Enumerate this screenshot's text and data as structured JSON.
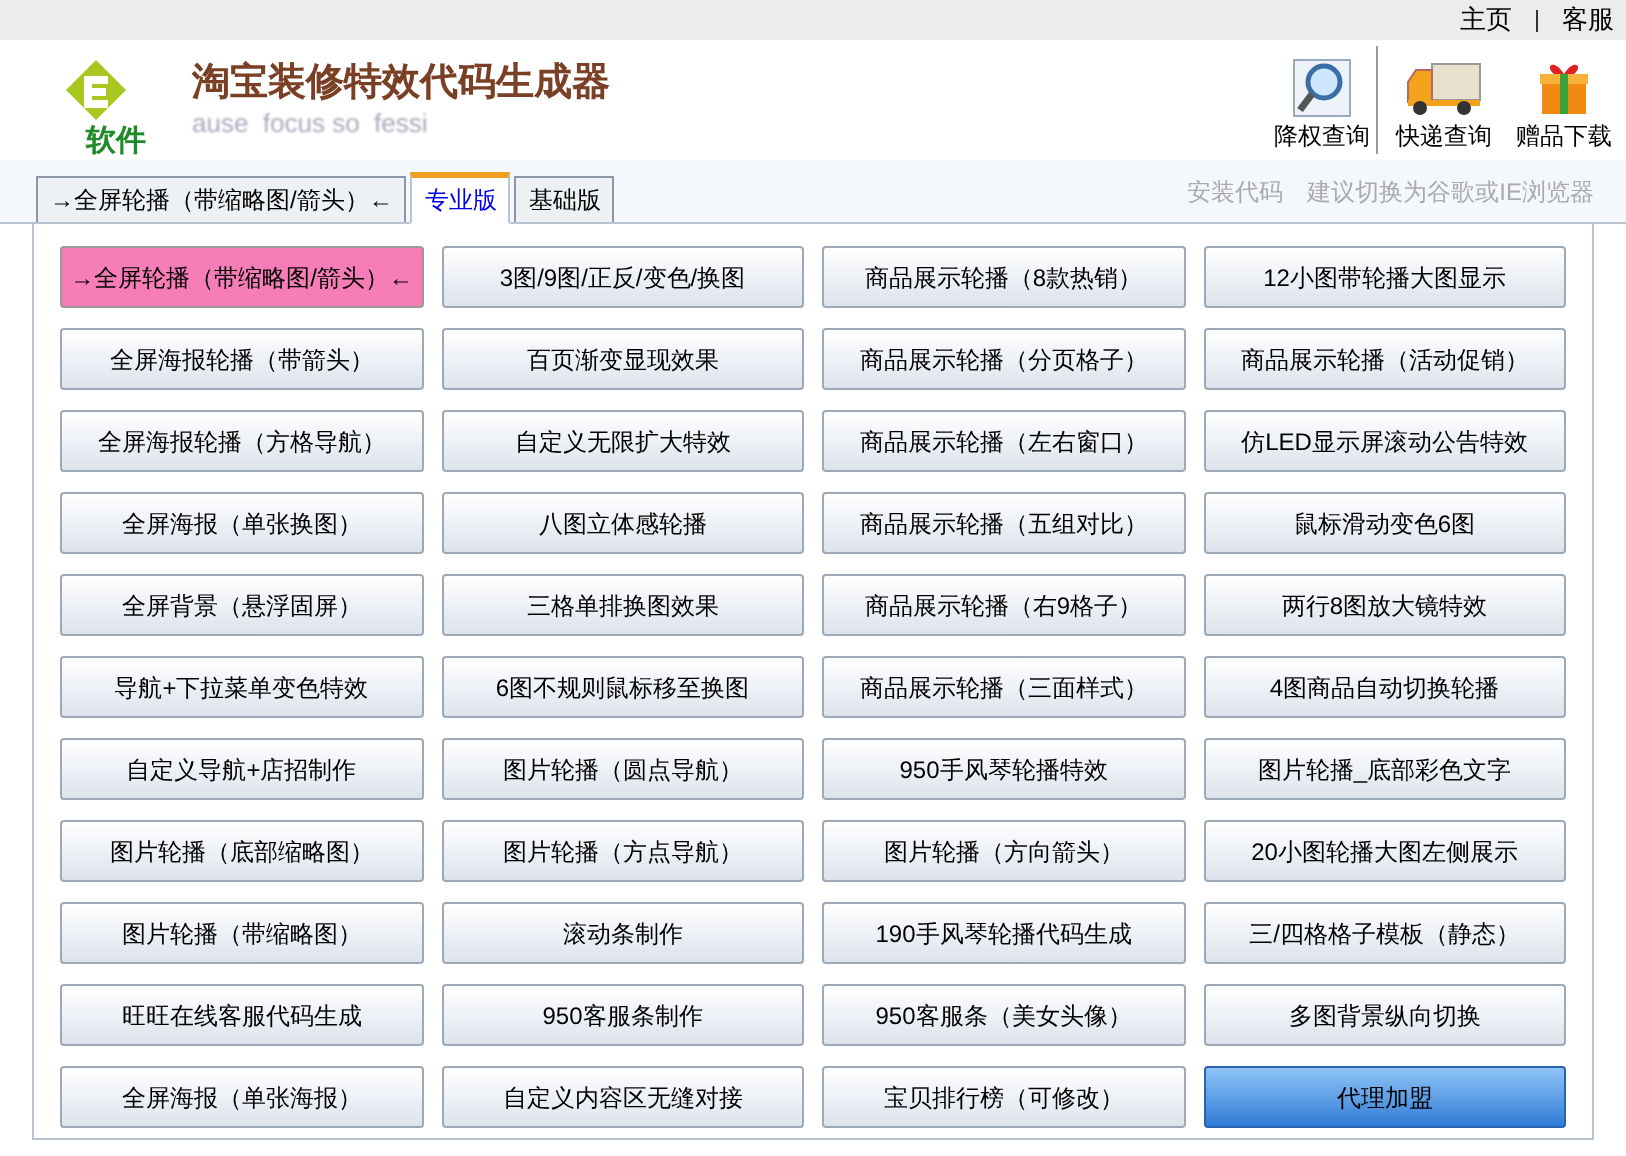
{
  "top_links": [
    "主页",
    "客服"
  ],
  "header": {
    "logo_text": "软件",
    "title": "淘宝装修特效代码生成器",
    "subtitle": "ause  focus so  fessi",
    "tools": [
      {
        "label": "降权查询",
        "kind": "search"
      },
      {
        "label": "快递查询",
        "kind": "truck"
      },
      {
        "label": "赠品下载",
        "kind": "gift"
      }
    ]
  },
  "tabs": [
    {
      "label": "→全屏轮播（带缩略图/箭头）←",
      "selected": false
    },
    {
      "label": "专业版",
      "selected": true
    },
    {
      "label": "基础版",
      "selected": false
    }
  ],
  "notes": [
    "安装代码",
    "建议切换为谷歌或IE浏览器"
  ],
  "buttons": [
    {
      "label": "→全屏轮播（带缩略图/箭头）←",
      "selected": true,
      "kind": "normal"
    },
    {
      "label": "3图/9图/正反/变色/换图",
      "selected": false,
      "kind": "normal"
    },
    {
      "label": "商品展示轮播（8款热销）",
      "selected": false,
      "kind": "normal"
    },
    {
      "label": "12小图带轮播大图显示",
      "selected": false,
      "kind": "normal"
    },
    {
      "label": "全屏海报轮播（带箭头）",
      "selected": false,
      "kind": "normal"
    },
    {
      "label": "百页渐变显现效果",
      "selected": false,
      "kind": "normal"
    },
    {
      "label": "商品展示轮播（分页格子）",
      "selected": false,
      "kind": "normal"
    },
    {
      "label": "商品展示轮播（活动促销）",
      "selected": false,
      "kind": "normal"
    },
    {
      "label": "全屏海报轮播（方格导航）",
      "selected": false,
      "kind": "normal"
    },
    {
      "label": "自定义无限扩大特效",
      "selected": false,
      "kind": "normal"
    },
    {
      "label": "商品展示轮播（左右窗口）",
      "selected": false,
      "kind": "normal"
    },
    {
      "label": "仿LED显示屏滚动公告特效",
      "selected": false,
      "kind": "normal"
    },
    {
      "label": "全屏海报（单张换图）",
      "selected": false,
      "kind": "normal"
    },
    {
      "label": "八图立体感轮播",
      "selected": false,
      "kind": "normal"
    },
    {
      "label": "商品展示轮播（五组对比）",
      "selected": false,
      "kind": "normal"
    },
    {
      "label": "鼠标滑动变色6图",
      "selected": false,
      "kind": "normal"
    },
    {
      "label": "全屏背景（悬浮固屏）",
      "selected": false,
      "kind": "normal"
    },
    {
      "label": "三格单排换图效果",
      "selected": false,
      "kind": "normal"
    },
    {
      "label": "商品展示轮播（右9格子）",
      "selected": false,
      "kind": "normal"
    },
    {
      "label": "两行8图放大镜特效",
      "selected": false,
      "kind": "normal"
    },
    {
      "label": "导航+下拉菜单变色特效",
      "selected": false,
      "kind": "normal"
    },
    {
      "label": "6图不规则鼠标移至换图",
      "selected": false,
      "kind": "normal"
    },
    {
      "label": "商品展示轮播（三面样式）",
      "selected": false,
      "kind": "normal"
    },
    {
      "label": "4图商品自动切换轮播",
      "selected": false,
      "kind": "normal"
    },
    {
      "label": "自定义导航+店招制作",
      "selected": false,
      "kind": "normal"
    },
    {
      "label": "图片轮播（圆点导航）",
      "selected": false,
      "kind": "normal"
    },
    {
      "label": "950手风琴轮播特效",
      "selected": false,
      "kind": "normal"
    },
    {
      "label": "图片轮播_底部彩色文字",
      "selected": false,
      "kind": "normal"
    },
    {
      "label": "图片轮播（底部缩略图）",
      "selected": false,
      "kind": "normal"
    },
    {
      "label": "图片轮播（方点导航）",
      "selected": false,
      "kind": "normal"
    },
    {
      "label": "图片轮播（方向箭头）",
      "selected": false,
      "kind": "normal"
    },
    {
      "label": "20小图轮播大图左侧展示",
      "selected": false,
      "kind": "normal"
    },
    {
      "label": "图片轮播（带缩略图）",
      "selected": false,
      "kind": "normal"
    },
    {
      "label": "滚动条制作",
      "selected": false,
      "kind": "normal"
    },
    {
      "label": "190手风琴轮播代码生成",
      "selected": false,
      "kind": "normal"
    },
    {
      "label": "三/四格格子模板（静态）",
      "selected": false,
      "kind": "normal"
    },
    {
      "label": "旺旺在线客服代码生成",
      "selected": false,
      "kind": "normal"
    },
    {
      "label": "950客服条制作",
      "selected": false,
      "kind": "normal"
    },
    {
      "label": "950客服条（美女头像）",
      "selected": false,
      "kind": "normal"
    },
    {
      "label": "多图背景纵向切换",
      "selected": false,
      "kind": "normal"
    },
    {
      "label": "全屏海报（单张海报）",
      "selected": false,
      "kind": "normal"
    },
    {
      "label": "自定义内容区无缝对接",
      "selected": false,
      "kind": "normal"
    },
    {
      "label": "宝贝排行榜（可修改）",
      "selected": false,
      "kind": "normal"
    },
    {
      "label": "代理加盟",
      "selected": false,
      "kind": "accent"
    }
  ]
}
